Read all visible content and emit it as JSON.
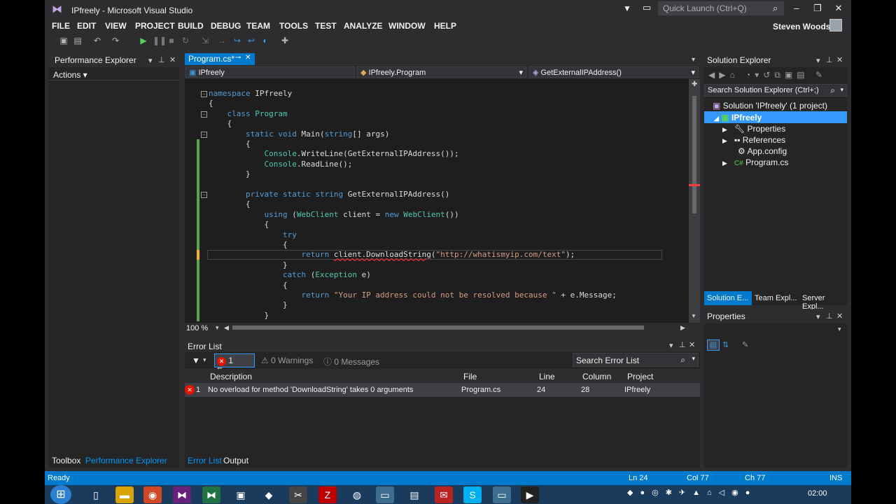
{
  "window": {
    "title": "IPfreely - Microsoft Visual Studio",
    "quick_launch": "Quick Launch (Ctrl+Q)",
    "user": "Steven Woods"
  },
  "menu": [
    "FILE",
    "EDIT",
    "VIEW",
    "PROJECT",
    "BUILD",
    "DEBUG",
    "TEAM",
    "TOOLS",
    "TEST",
    "ANALYZE",
    "WINDOW",
    "HELP"
  ],
  "left_panel": {
    "title": "Performance Explorer",
    "actions": "Actions ▾",
    "bottom_tabs": [
      "Toolbox",
      "Performance Explorer"
    ]
  },
  "editor": {
    "tab": "Program.cs*",
    "nav": [
      "IPfreely",
      "IPfreely.Program",
      "GetExternalIPAddress()"
    ],
    "zoom": "100 %",
    "lines": [
      {
        "tokens": [
          [
            "kw",
            "namespace"
          ],
          [
            "",
            ""
          ],
          [
            "pl",
            " IPfreely"
          ]
        ]
      },
      {
        "tokens": [
          [
            "pl",
            "{"
          ]
        ]
      },
      {
        "tokens": [
          [
            "pl",
            "    "
          ],
          [
            "kw",
            "class"
          ],
          [
            "pl",
            " "
          ],
          [
            "ty",
            "Program"
          ]
        ]
      },
      {
        "tokens": [
          [
            "pl",
            "    {"
          ]
        ]
      },
      {
        "tokens": [
          [
            "pl",
            "        "
          ],
          [
            "kw",
            "static"
          ],
          [
            "pl",
            " "
          ],
          [
            "kw",
            "void"
          ],
          [
            "pl",
            " Main("
          ],
          [
            "kw",
            "string"
          ],
          [
            "pl",
            "[] args)"
          ]
        ]
      },
      {
        "tokens": [
          [
            "pl",
            "        {"
          ]
        ]
      },
      {
        "tokens": [
          [
            "pl",
            "            "
          ],
          [
            "ty",
            "Console"
          ],
          [
            "pl",
            ".WriteLine(GetExternalIPAddress());"
          ]
        ]
      },
      {
        "tokens": [
          [
            "pl",
            "            "
          ],
          [
            "ty",
            "Console"
          ],
          [
            "pl",
            ".ReadLine();"
          ]
        ]
      },
      {
        "tokens": [
          [
            "pl",
            "        }"
          ]
        ]
      },
      {
        "tokens": [
          [
            "pl",
            ""
          ]
        ]
      },
      {
        "tokens": [
          [
            "pl",
            "        "
          ],
          [
            "kw",
            "private"
          ],
          [
            "pl",
            " "
          ],
          [
            "kw",
            "static"
          ],
          [
            "pl",
            " "
          ],
          [
            "kw",
            "string"
          ],
          [
            "pl",
            " GetExternalIPAddress()"
          ]
        ]
      },
      {
        "tokens": [
          [
            "pl",
            "        {"
          ]
        ]
      },
      {
        "tokens": [
          [
            "pl",
            "            "
          ],
          [
            "kw",
            "using"
          ],
          [
            "pl",
            " ("
          ],
          [
            "ty",
            "WebClient"
          ],
          [
            "pl",
            " client = "
          ],
          [
            "kw",
            "new"
          ],
          [
            "pl",
            " "
          ],
          [
            "ty",
            "WebClient"
          ],
          [
            "pl",
            "())"
          ]
        ]
      },
      {
        "tokens": [
          [
            "pl",
            "            {"
          ]
        ]
      },
      {
        "tokens": [
          [
            "pl",
            "                "
          ],
          [
            "kw",
            "try"
          ]
        ]
      },
      {
        "tokens": [
          [
            "pl",
            "                {"
          ]
        ]
      },
      {
        "tokens": [
          [
            "pl",
            "                    "
          ],
          [
            "kw",
            "return"
          ],
          [
            "pl",
            " "
          ],
          [
            "sq",
            "client.DownloadString"
          ],
          [
            "pl",
            "("
          ],
          [
            "str",
            "\"http://whatismyip.com/text\""
          ],
          [
            "pl",
            ");"
          ]
        ]
      },
      {
        "tokens": [
          [
            "pl",
            "                }"
          ]
        ]
      },
      {
        "tokens": [
          [
            "pl",
            "                "
          ],
          [
            "kw",
            "catch"
          ],
          [
            "pl",
            " ("
          ],
          [
            "ty",
            "Exception"
          ],
          [
            "pl",
            " e)"
          ]
        ]
      },
      {
        "tokens": [
          [
            "pl",
            "                {"
          ]
        ]
      },
      {
        "tokens": [
          [
            "pl",
            "                    "
          ],
          [
            "kw",
            "return"
          ],
          [
            "pl",
            " "
          ],
          [
            "str",
            "\"Your IP address could not be resolved because \""
          ],
          [
            "pl",
            " + e.Message;"
          ]
        ]
      },
      {
        "tokens": [
          [
            "pl",
            "                }"
          ]
        ]
      },
      {
        "tokens": [
          [
            "pl",
            "            }"
          ]
        ]
      }
    ]
  },
  "error_list": {
    "title": "Error List",
    "errors_btn": "1 Error",
    "warnings_btn": "0 Warnings",
    "messages_btn": "0 Messages",
    "search_placeholder": "Search Error List",
    "columns": [
      "Description",
      "File",
      "Line",
      "Column",
      "Project"
    ],
    "rows": [
      {
        "num": "1",
        "description": "No overload for method 'DownloadString' takes 0 arguments",
        "file": "Program.cs",
        "line": "24",
        "column": "28",
        "project": "IPfreely"
      }
    ],
    "bottom_tabs": [
      "Error List",
      "Output"
    ]
  },
  "solution_explorer": {
    "title": "Solution Explorer",
    "search_placeholder": "Search Solution Explorer (Ctrl+;)",
    "solution": "Solution 'IPfreely' (1 project)",
    "project": "IPfreely",
    "items": [
      "Properties",
      "References",
      "App.config",
      "Program.cs"
    ],
    "bottom_tabs": [
      "Solution E...",
      "Team Expl...",
      "Server Expl..."
    ]
  },
  "properties": {
    "title": "Properties"
  },
  "status": {
    "left": "Ready",
    "ln": "Ln 24",
    "col": "Col 77",
    "ch": "Ch 77",
    "mode": "INS"
  },
  "taskbar": {
    "time": "02:00"
  }
}
